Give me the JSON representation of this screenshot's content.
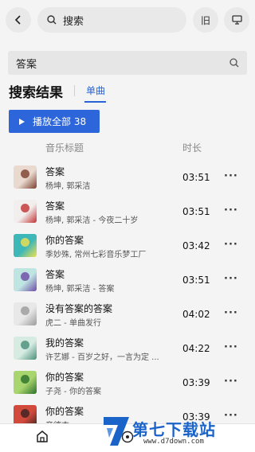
{
  "topbar": {
    "search_placeholder": "搜索",
    "old_label": "旧"
  },
  "search": {
    "query": "答案"
  },
  "results": {
    "title": "搜索结果",
    "tab_label": "单曲",
    "play_all_label": "播放全部 38"
  },
  "columns": {
    "title": "音乐标题",
    "duration": "时长"
  },
  "songs": [
    {
      "title": "答案",
      "artist": "杨坤, 郭采洁",
      "duration": "03:51",
      "cover_bg": "#ead9cf",
      "cover_fg": "#7a3f2c"
    },
    {
      "title": "答案",
      "artist": "杨坤, 郭采洁 - 今夜二十岁",
      "duration": "03:51",
      "cover_bg": "#f2eeee",
      "cover_fg": "#c23030"
    },
    {
      "title": "你的答案",
      "artist": "季妙殊, 常州七彩音乐梦工厂",
      "duration": "03:42",
      "cover_bg": "#3db7b8",
      "cover_fg": "#f4e04d"
    },
    {
      "title": "答案",
      "artist": "杨坤, 郭采洁 - 答案",
      "duration": "03:51",
      "cover_bg": "#bfe5e3",
      "cover_fg": "#6b4aa5"
    },
    {
      "title": "没有答案的答案",
      "artist": "虎二 - 单曲发行",
      "duration": "04:02",
      "cover_bg": "#e8e8e8",
      "cover_fg": "#9a9a9a"
    },
    {
      "title": "我的答案",
      "artist": "许艺娜 - 百岁之好，一言为定 ...",
      "duration": "04:22",
      "cover_bg": "#d6ece3",
      "cover_fg": "#4a8e7a"
    },
    {
      "title": "你的答案",
      "artist": "子尧 - 你的答案",
      "duration": "03:39",
      "cover_bg": "#a8d56d",
      "cover_fg": "#2b6e2b"
    },
    {
      "title": "你的答案",
      "artist": "音德杰",
      "duration": "03:39",
      "cover_bg": "#d24a3c",
      "cover_fg": "#3a2020"
    }
  ],
  "more_glyph": "···",
  "watermark": {
    "cn": "第七下载站",
    "url": "www.d7down.com"
  },
  "colors": {
    "accent": "#2c66da",
    "watermark": "#1a63c9"
  }
}
